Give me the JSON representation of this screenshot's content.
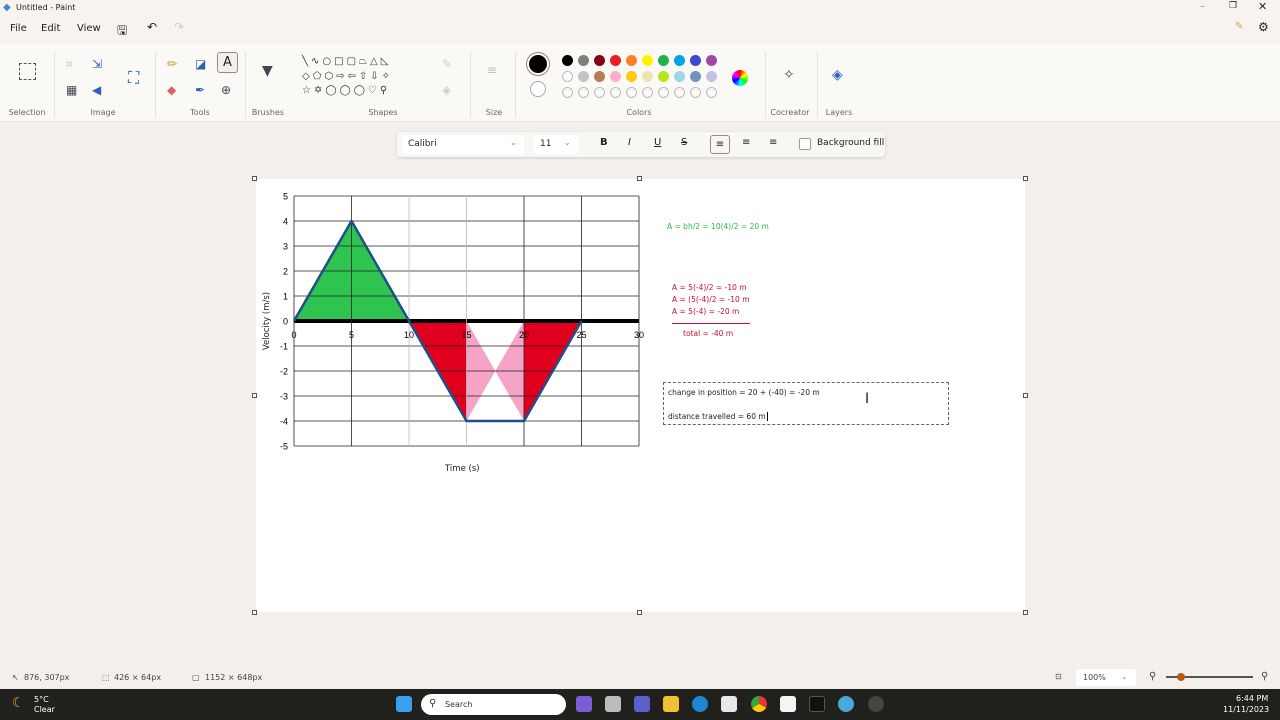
{
  "window": {
    "title": "Untitled - Paint"
  },
  "menu": {
    "file": "File",
    "edit": "Edit",
    "view": "View"
  },
  "ribbon": {
    "groups": [
      "Selection",
      "Image",
      "Tools",
      "Brushes",
      "Shapes",
      "Size",
      "Colors",
      "Cocreator",
      "Layers"
    ]
  },
  "colors": {
    "primary": "#000000",
    "secondary": "#ffffff",
    "row1": [
      "#000000",
      "#7f7f7f",
      "#880015",
      "#ed1c24",
      "#ff7f27",
      "#fff200",
      "#22b14c",
      "#00a2e8",
      "#3f48cc",
      "#a349a4"
    ],
    "row2": [
      "#ffffff",
      "#c3c3c3",
      "#b97a57",
      "#ffaec9",
      "#ffc90e",
      "#efe4b0",
      "#b5e61d",
      "#99d9ea",
      "#7092be",
      "#c8bfe7"
    ]
  },
  "textbar": {
    "font": "Calibri",
    "size": "11",
    "bold": "B",
    "italic": "I",
    "underline": "U",
    "strike": "S",
    "background_fill": "Background fill"
  },
  "notes": {
    "green": "A = bh/2 = 10(4)/2 = 20 m",
    "red1": "A = 5(-4)/2 = -10 m",
    "red2": "A = (5(-4)/2 = -10 m",
    "red3": "A = 5(-4) = -20 m",
    "total": "total = -40 m",
    "change": "change in position = 20 + (-40) = -20 m",
    "distance": "distance travelled = 60 m"
  },
  "chart_data": {
    "type": "line",
    "title": "",
    "xlabel": "Time (s)",
    "ylabel": "Velocity (m/s)",
    "x": [
      0,
      5,
      10,
      15,
      20,
      25
    ],
    "y": [
      0,
      4,
      0,
      -4,
      -4,
      0
    ],
    "xlim": [
      0,
      30
    ],
    "ylim": [
      -5,
      5
    ],
    "xticks": [
      "0",
      "5",
      "10",
      "15",
      "20",
      "25",
      "30"
    ],
    "yticks": [
      "5",
      "4",
      "3",
      "2",
      "1",
      "0",
      "-1",
      "-2",
      "-3",
      "-4",
      "-5"
    ],
    "grid": true,
    "fills": [
      {
        "from": 0,
        "to": 10,
        "color": "#2ec44f"
      },
      {
        "from": 10,
        "to": 15,
        "color": "#e0001e"
      },
      {
        "from": 15,
        "to": 20,
        "color": "#f5a3c7"
      },
      {
        "from": 20,
        "to": 25,
        "color": "#e0001e"
      }
    ]
  },
  "status": {
    "cursor": "876, 307px",
    "selection": "426 × 64px",
    "canvas": "1152 × 648px",
    "zoom": "100%"
  },
  "taskbar": {
    "temp": "5°C",
    "weather": "Clear",
    "search": "Search",
    "time": "6:44 PM",
    "date": "11/11/2023"
  }
}
